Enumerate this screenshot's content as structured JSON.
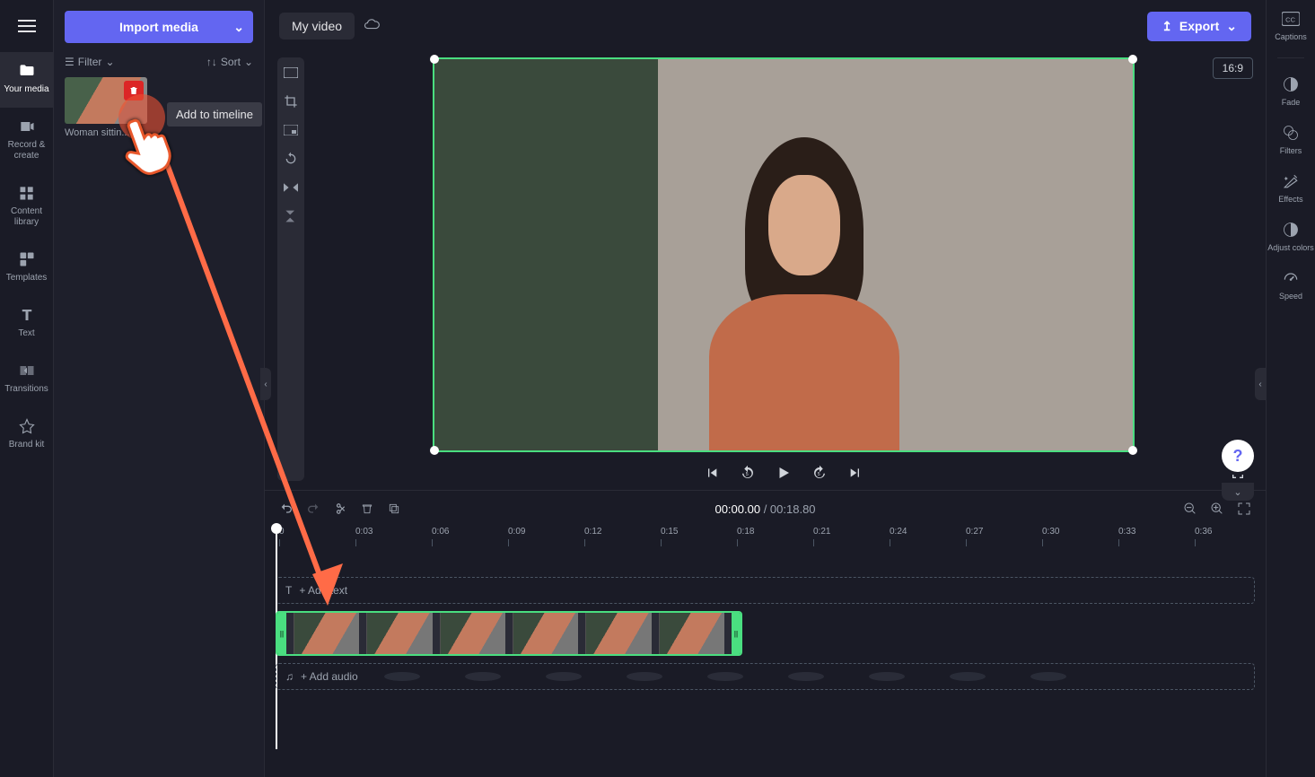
{
  "leftRail": {
    "items": [
      {
        "label": "Your media"
      },
      {
        "label": "Record & create"
      },
      {
        "label": "Content library"
      },
      {
        "label": "Templates"
      },
      {
        "label": "Text"
      },
      {
        "label": "Transitions"
      },
      {
        "label": "Brand kit"
      }
    ]
  },
  "mediaPanel": {
    "importLabel": "Import media",
    "filterLabel": "Filter",
    "sortLabel": "Sort",
    "thumbLabel": "Woman sittin...",
    "tooltip": "Add to timeline"
  },
  "topbar": {
    "title": "My video",
    "exportLabel": "Export",
    "ratio": "16:9"
  },
  "playback": {
    "currentTime": "00:00.00",
    "totalTime": "00:18.80"
  },
  "ruler": {
    "ticks": [
      "0",
      "0:03",
      "0:06",
      "0:09",
      "0:12",
      "0:15",
      "0:18",
      "0:21",
      "0:24",
      "0:27",
      "0:30",
      "0:33",
      "0:36"
    ]
  },
  "tracks": {
    "textPlaceholder": "+ Add text",
    "audioPlaceholder": "+ Add audio"
  },
  "rightRail": {
    "items": [
      {
        "label": "Captions"
      },
      {
        "label": "Fade"
      },
      {
        "label": "Filters"
      },
      {
        "label": "Effects"
      },
      {
        "label": "Adjust colors"
      },
      {
        "label": "Speed"
      }
    ]
  },
  "help": "?"
}
